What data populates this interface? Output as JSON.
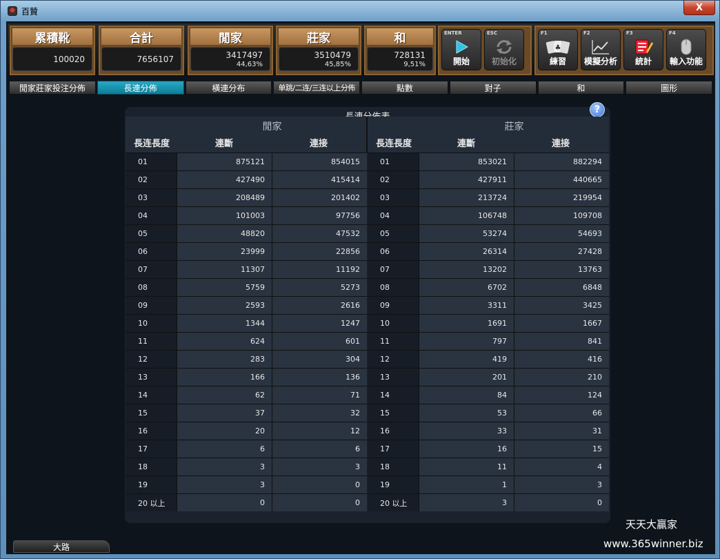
{
  "window": {
    "title": "百贊",
    "close_label": "X"
  },
  "stats": [
    {
      "label": "累積靴",
      "value": "100020",
      "pct": ""
    },
    {
      "label": "合計",
      "value": "7656107",
      "pct": ""
    },
    {
      "label": "閒家",
      "value": "3417497",
      "pct": "44,63%"
    },
    {
      "label": "莊家",
      "value": "3510479",
      "pct": "45,85%"
    },
    {
      "label": "和",
      "value": "728131",
      "pct": "9,51%"
    }
  ],
  "buttons": [
    {
      "key": "ENTER",
      "label": "開始",
      "icon": "play-icon"
    },
    {
      "key": "ESC",
      "label": "初始化",
      "icon": "refresh-icon"
    },
    {
      "key": "F1",
      "label": "練習",
      "icon": "cards-icon"
    },
    {
      "key": "F2",
      "label": "模擬分析",
      "icon": "chart-icon"
    },
    {
      "key": "F3",
      "label": "統計",
      "icon": "notepad-icon"
    },
    {
      "key": "F4",
      "label": "輸入功能",
      "icon": "mouse-icon"
    }
  ],
  "tabs": [
    "閒家莊家投注分佈",
    "長連分佈",
    "橫連分布",
    "单跳/二连/三连以上分佈",
    "點數",
    "對子",
    "和",
    "圖形"
  ],
  "panel": {
    "title": "長連分佈表",
    "help": "?",
    "player": {
      "title": "閒家",
      "col_len": "長连長度",
      "col_break": "連斷",
      "col_cont": "連接"
    },
    "banker": {
      "title": "莊家",
      "col_len": "長连長度",
      "col_break": "連斷",
      "col_cont": "連接"
    }
  },
  "player_rows": [
    [
      "01",
      "875121",
      "854015"
    ],
    [
      "02",
      "427490",
      "415414"
    ],
    [
      "03",
      "208489",
      "201402"
    ],
    [
      "04",
      "101003",
      "97756"
    ],
    [
      "05",
      "48820",
      "47532"
    ],
    [
      "06",
      "23999",
      "22856"
    ],
    [
      "07",
      "11307",
      "11192"
    ],
    [
      "08",
      "5759",
      "5273"
    ],
    [
      "09",
      "2593",
      "2616"
    ],
    [
      "10",
      "1344",
      "1247"
    ],
    [
      "11",
      "624",
      "601"
    ],
    [
      "12",
      "283",
      "304"
    ],
    [
      "13",
      "166",
      "136"
    ],
    [
      "14",
      "62",
      "71"
    ],
    [
      "15",
      "37",
      "32"
    ],
    [
      "16",
      "20",
      "12"
    ],
    [
      "17",
      "6",
      "6"
    ],
    [
      "18",
      "3",
      "3"
    ],
    [
      "19",
      "3",
      "0"
    ],
    [
      "20 以上",
      "0",
      "0"
    ]
  ],
  "banker_rows": [
    [
      "01",
      "853021",
      "882294"
    ],
    [
      "02",
      "427911",
      "440665"
    ],
    [
      "03",
      "213724",
      "219954"
    ],
    [
      "04",
      "106748",
      "109708"
    ],
    [
      "05",
      "53274",
      "54693"
    ],
    [
      "06",
      "26314",
      "27428"
    ],
    [
      "07",
      "13202",
      "13763"
    ],
    [
      "08",
      "6702",
      "6848"
    ],
    [
      "09",
      "3311",
      "3425"
    ],
    [
      "10",
      "1691",
      "1667"
    ],
    [
      "11",
      "797",
      "841"
    ],
    [
      "12",
      "419",
      "416"
    ],
    [
      "13",
      "201",
      "210"
    ],
    [
      "14",
      "84",
      "124"
    ],
    [
      "15",
      "53",
      "66"
    ],
    [
      "16",
      "33",
      "31"
    ],
    [
      "17",
      "16",
      "15"
    ],
    [
      "18",
      "11",
      "4"
    ],
    [
      "19",
      "1",
      "3"
    ],
    [
      "20 以上",
      "3",
      "0"
    ]
  ],
  "bottom_tab": "大路",
  "watermark": {
    "line1": "天天大贏家",
    "line2": "www.365winner.biz"
  }
}
